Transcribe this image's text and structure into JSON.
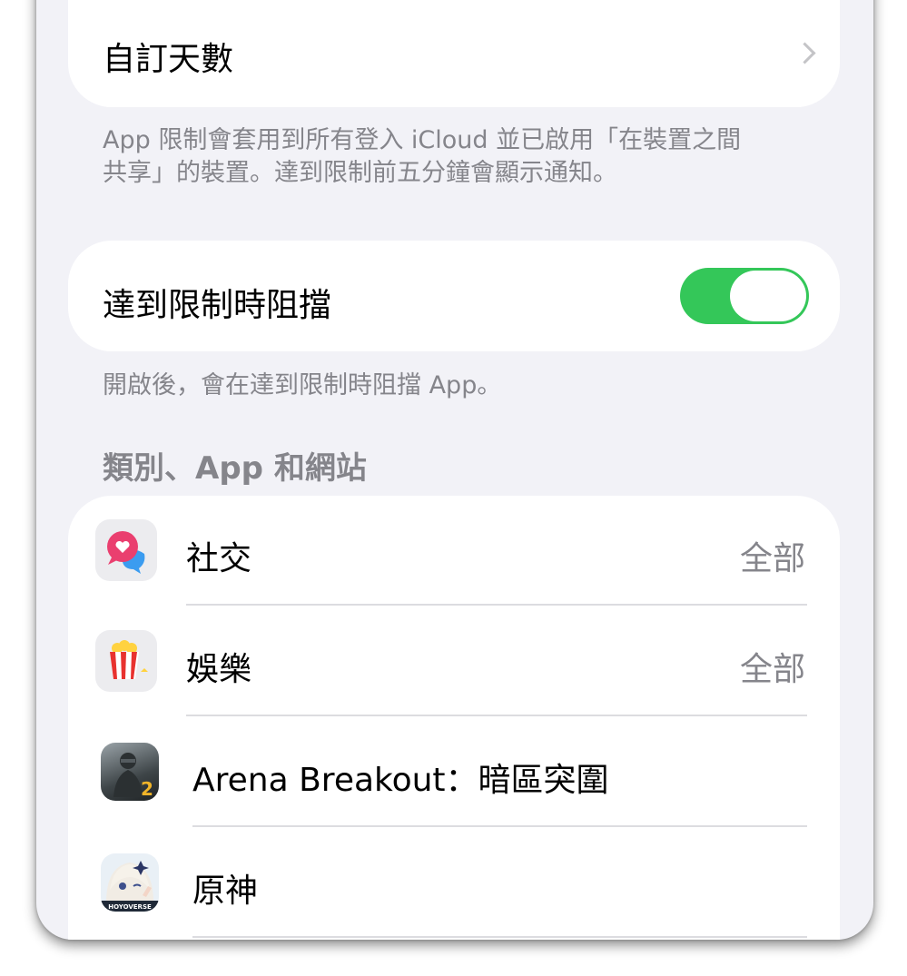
{
  "custom_days": {
    "label": "自訂天數"
  },
  "limits_note": {
    "line1": "App 限制會套用到所有登入 iCloud 並已啟用「在裝置之間",
    "line2": "共享」的裝置。達到限制前五分鐘會顯示通知。"
  },
  "block_at_limit": {
    "label": "達到限制時阻擋",
    "enabled": true,
    "note": "開啟後，會在達到限制時阻擋 App。"
  },
  "section": {
    "title": "類別、App 和網站"
  },
  "items": [
    {
      "label": "社交",
      "value": "全部",
      "icon": "social-chat-icon"
    },
    {
      "label": "娛樂",
      "value": "全部",
      "icon": "popcorn-icon"
    },
    {
      "label": "Arena Breakout：暗區突圍",
      "value": "",
      "icon": "arena-breakout-app-icon"
    },
    {
      "label": "原神",
      "value": "",
      "icon": "genshin-app-icon"
    }
  ],
  "icon_labels": {
    "arena_badge": "2",
    "genshin_badge": "HOYOVERSE"
  },
  "colors": {
    "toggle_on": "#34c759",
    "background": "#f2f2f7",
    "secondary_text": "#85858b"
  }
}
